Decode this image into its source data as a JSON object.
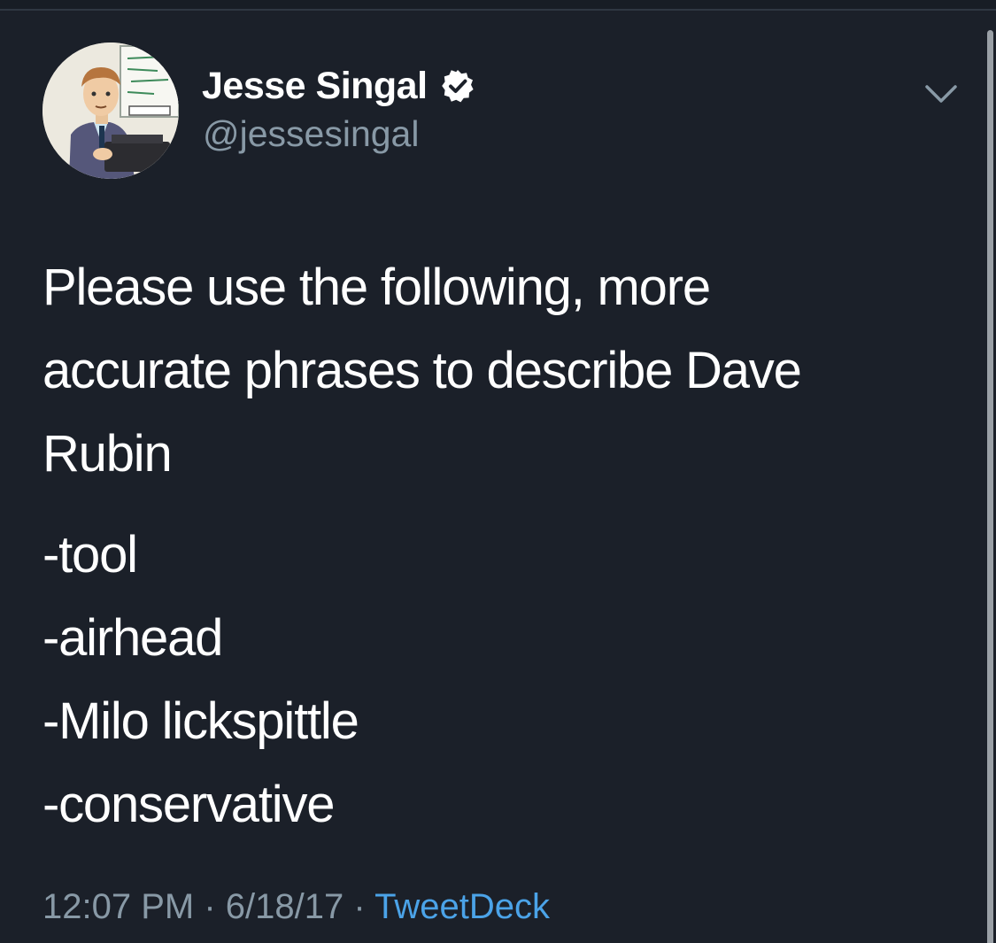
{
  "tweet": {
    "author": {
      "display_name": "Jesse Singal",
      "username": "@jessesingal",
      "verified": true
    },
    "text_lines": [
      "Please use the following, more",
      "accurate phrases to describe Dave",
      "Rubin"
    ],
    "list_items": [
      "-tool",
      "-airhead",
      "-Milo lickspittle",
      "-conservative"
    ],
    "time": "12:07 PM",
    "date": "6/18/17",
    "separator": "·",
    "source": "TweetDeck"
  },
  "icons": {
    "verified": "verified-badge-icon",
    "menu": "chevron-down-icon"
  },
  "colors": {
    "background": "#1b2029",
    "text": "#ffffff",
    "secondary_text": "#8899a6",
    "link": "#4ba3e8"
  }
}
